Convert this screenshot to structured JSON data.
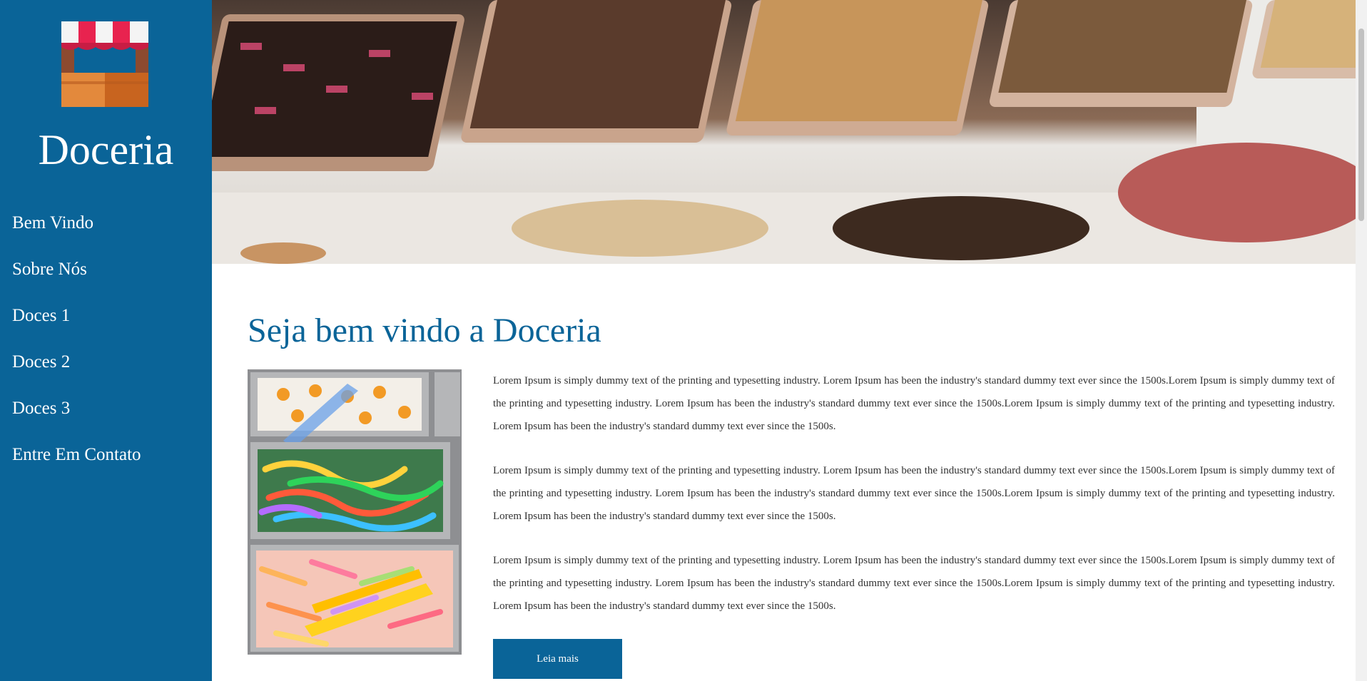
{
  "sidebar": {
    "brand": "Doceria",
    "nav": [
      "Bem Vindo",
      "Sobre Nós",
      "Doces 1",
      "Doces 2",
      "Doces 3",
      "Entre Em Contato"
    ]
  },
  "main": {
    "title": "Seja bem vindo a Doceria",
    "paragraphs": [
      "Lorem Ipsum is simply dummy text of the printing and typesetting industry. Lorem Ipsum has been the industry's standard dummy text ever since the 1500s.Lorem Ipsum is simply dummy text of the printing and typesetting industry. Lorem Ipsum has been the industry's standard dummy text ever since the 1500s.Lorem Ipsum is simply dummy text of the printing and typesetting industry. Lorem Ipsum has been the industry's standard dummy text ever since the 1500s.",
      "Lorem Ipsum is simply dummy text of the printing and typesetting industry. Lorem Ipsum has been the industry's standard dummy text ever since the 1500s.Lorem Ipsum is simply dummy text of the printing and typesetting industry. Lorem Ipsum has been the industry's standard dummy text ever since the 1500s.Lorem Ipsum is simply dummy text of the printing and typesetting industry. Lorem Ipsum has been the industry's standard dummy text ever since the 1500s.",
      "Lorem Ipsum is simply dummy text of the printing and typesetting industry. Lorem Ipsum has been the industry's standard dummy text ever since the 1500s.Lorem Ipsum is simply dummy text of the printing and typesetting industry. Lorem Ipsum has been the industry's standard dummy text ever since the 1500s.Lorem Ipsum is simply dummy text of the printing and typesetting industry. Lorem Ipsum has been the industry's standard dummy text ever since the 1500s."
    ],
    "button_label": "Leia mais"
  },
  "icons": {
    "logo": "shop-awning-icon",
    "hero": "pastry-display-photo",
    "candy": "gummy-candy-photo"
  },
  "colors": {
    "primary": "#0a6498",
    "text": "#333333",
    "background": "#ffffff"
  }
}
